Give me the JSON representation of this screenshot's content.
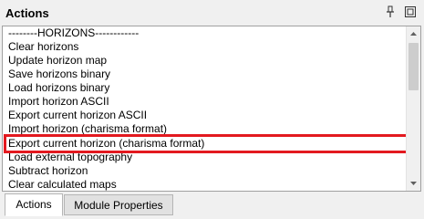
{
  "panel": {
    "title": "Actions",
    "pin_icon": "pin-icon",
    "float_icon": "float-window-icon"
  },
  "actions": {
    "items": [
      "--------HORIZONS------------",
      "Clear horizons",
      "Update horizon map",
      "Save horizons binary",
      "Load horizons binary",
      "Import horizon ASCII",
      "Export current horizon ASCII",
      "Import horizon (charisma format)",
      "Export current horizon (charisma format)",
      "Load external topography",
      "Subtract horizon",
      "Clear calculated maps"
    ],
    "selected_index": 8
  },
  "tabs": [
    "Actions",
    "Module Properties"
  ],
  "colors": {
    "highlight_border": "#e3191f",
    "list_background": "#ffffff",
    "panel_background": "#f0f0f0"
  }
}
